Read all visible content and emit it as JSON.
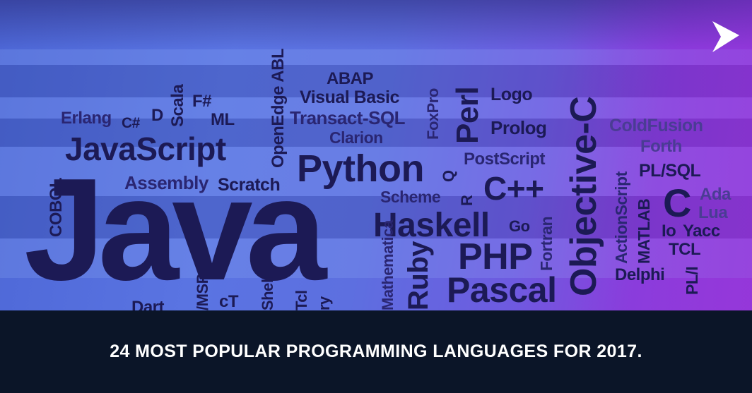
{
  "colors": {
    "dark_word": "#1c1a55",
    "mid_word": "#2a2672",
    "soft_word": "#4a3c94",
    "light_word": "#9aa7ff",
    "footer_bg": "#0b1528",
    "headline": "#ffffff"
  },
  "icons": {
    "play": "play-arrow-icon"
  },
  "headline": "24 MOST POPULAR PROGRAMMING LANGUAGES FOR 2017.",
  "words": {
    "java": "Java",
    "javascript": "JavaScript",
    "python": "Python",
    "haskell": "Haskell",
    "php": "PHP",
    "pascal": "Pascal",
    "objective_c": "Objective-C",
    "cpp": "C++",
    "c": "C",
    "perl": "Perl",
    "abap": "ABAP",
    "visual_basic": "Visual Basic",
    "transact_sql": "Transact-SQL",
    "clarion": "Clarion",
    "foxpro": "FoxPro",
    "logo": "Logo",
    "prolog": "Prolog",
    "postscript": "PostScript",
    "coldfusion": "ColdFusion",
    "forth": "Forth",
    "pl_sql": "PL/SQL",
    "ada": "Ada",
    "lua": "Lua",
    "io": "Io",
    "yacc": "Yacc",
    "tcl": "TCL",
    "pl_i": "PL/I",
    "delphi": "Delphi",
    "matlab": "MATLAB",
    "actionscript": "ActionScript",
    "fortran": "Fortran",
    "go": "Go",
    "scheme": "Scheme",
    "r": "R",
    "q": "Q",
    "ruby": "Ruby",
    "mathematica": "Mathematica",
    "erlang": "Erlang",
    "csharp": "C#",
    "d": "D",
    "scala": "Scala",
    "fsharp": "F#",
    "ml": "ML",
    "openedge": "OpenEdge ABL",
    "assembly": "Assembly",
    "scratch": "Scratch",
    "cobol": "COBOL",
    "dart": "Dart",
    "msp": "/MSP",
    "ct": "cT",
    "shell": "Shell",
    "tcl_small": "Tcl",
    "ry": "ry"
  }
}
